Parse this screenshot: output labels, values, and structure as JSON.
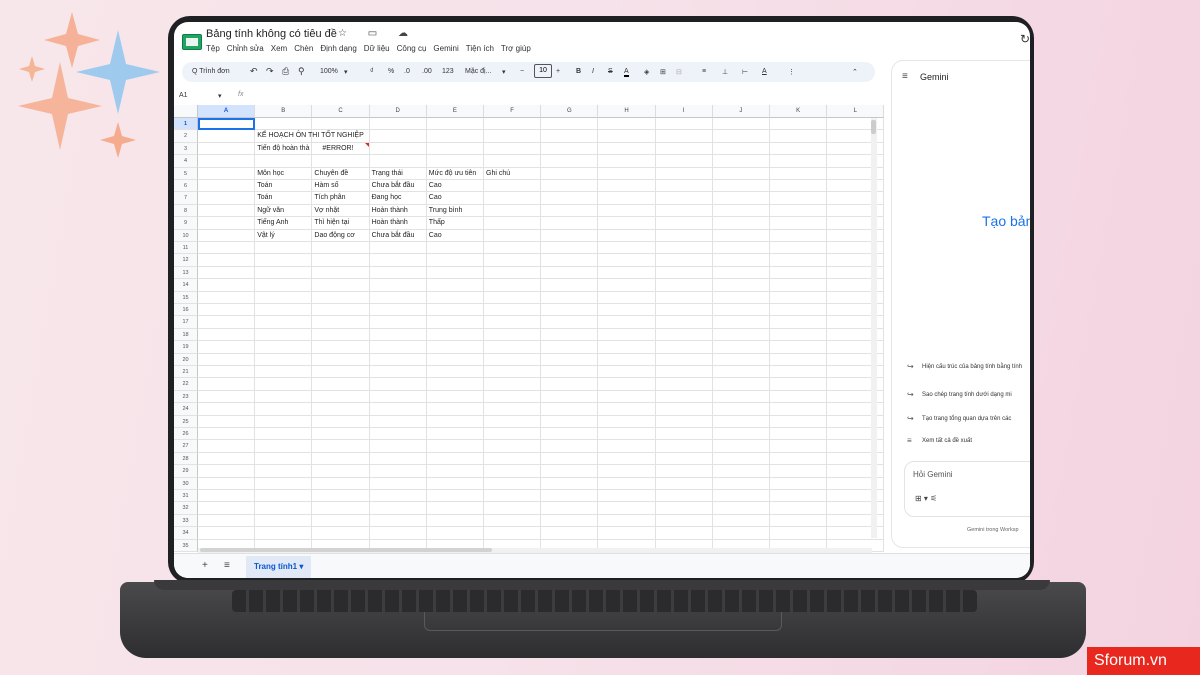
{
  "app": {
    "doc_title": "Bảng tính không có tiêu đề",
    "title_icons": "☆ ▭ ☁",
    "menus": [
      "Tệp",
      "Chỉnh sửa",
      "Xem",
      "Chèn",
      "Định dạng",
      "Dữ liệu",
      "Công cụ",
      "Gemini",
      "Tiện ích",
      "Trợ giúp"
    ]
  },
  "toolbar": {
    "search": "Q Trình đơn",
    "undo": "↶",
    "redo": "↷",
    "print": "⎙",
    "paint": "⚲",
    "zoom": "100%",
    "currency": "₫",
    "percent": "%",
    "dec_minus": ".0",
    "dec_plus": ".00",
    "num_fmt": "123",
    "font": "Mặc đị...",
    "minus": "−",
    "font_size": "10",
    "plus": "+",
    "bold": "B",
    "italic": "I",
    "strike": "S",
    "text_color": "A",
    "fill": "◈",
    "borders": "⊞",
    "merge": "⊟",
    "halign": "≡",
    "valign": "⊥",
    "wrap": "⊢",
    "rotate": "A",
    "more": "⋮",
    "collapse": "⌃"
  },
  "formula_bar": {
    "name_box": "A1",
    "fx": "fx"
  },
  "sheet": {
    "columns": [
      "A",
      "B",
      "C",
      "D",
      "E",
      "F",
      "G",
      "H",
      "I",
      "J",
      "K",
      "L"
    ],
    "row_count": 35,
    "selected_cell": "A1",
    "cells": [
      {
        "ref": "B2",
        "text": "KẾ HOẠCH ÔN THI TỐT NGHIỆP"
      },
      {
        "ref": "B3",
        "text": "Tiến độ hoàn thà"
      },
      {
        "ref": "C3",
        "text": "#ERROR!"
      },
      {
        "ref": "B5",
        "text": "Môn học"
      },
      {
        "ref": "C5",
        "text": "Chuyên đề"
      },
      {
        "ref": "D5",
        "text": "Trạng thái"
      },
      {
        "ref": "E5",
        "text": "Mức độ ưu tiên"
      },
      {
        "ref": "F5",
        "text": "Ghi chú"
      },
      {
        "ref": "B6",
        "text": "Toán"
      },
      {
        "ref": "C6",
        "text": "Hàm số"
      },
      {
        "ref": "D6",
        "text": "Chưa bắt đầu"
      },
      {
        "ref": "E6",
        "text": "Cao"
      },
      {
        "ref": "B7",
        "text": "Toán"
      },
      {
        "ref": "C7",
        "text": "Tích phân"
      },
      {
        "ref": "D7",
        "text": "Đang học"
      },
      {
        "ref": "E7",
        "text": "Cao"
      },
      {
        "ref": "B8",
        "text": "Ngữ văn"
      },
      {
        "ref": "C8",
        "text": "Vợ nhặt"
      },
      {
        "ref": "D8",
        "text": "Hoàn thành"
      },
      {
        "ref": "E8",
        "text": "Trung bình"
      },
      {
        "ref": "B9",
        "text": "Tiếng Anh"
      },
      {
        "ref": "C9",
        "text": "Thì hiện tại"
      },
      {
        "ref": "D9",
        "text": "Hoàn thành"
      },
      {
        "ref": "E9",
        "text": "Thấp"
      },
      {
        "ref": "B10",
        "text": "Vật lý"
      },
      {
        "ref": "C10",
        "text": "Dao động cơ"
      },
      {
        "ref": "D10",
        "text": "Chưa bắt đầu"
      },
      {
        "ref": "E10",
        "text": "Cao"
      }
    ]
  },
  "tabs": {
    "add": "+",
    "all_sheets": "≡",
    "active": "Trang tính1",
    "dropdown": "▾"
  },
  "gemini": {
    "menu_icon": "≡",
    "title": "Gemini",
    "hero": "Tạo bản",
    "suggestions": [
      "Hiện cấu trúc của bảng tính bằng tính",
      "Sao chép trang tính dưới dạng mi",
      "Tạo trang tổng quan dựa trên các"
    ],
    "suggestion_icon": "↪",
    "see_all_icon": "≡",
    "see_all": "Xem tất cả đề xuất",
    "ask_placeholder": "Hỏi Gemini",
    "ask_icons": "⊞ ▾   ⚟",
    "footer": "Gemini trong Worksp"
  },
  "watermark": "Sforum.vn",
  "colors": {
    "accent": "#1a73e8",
    "sheets_green": "#1fa463",
    "error": "#d93025"
  }
}
